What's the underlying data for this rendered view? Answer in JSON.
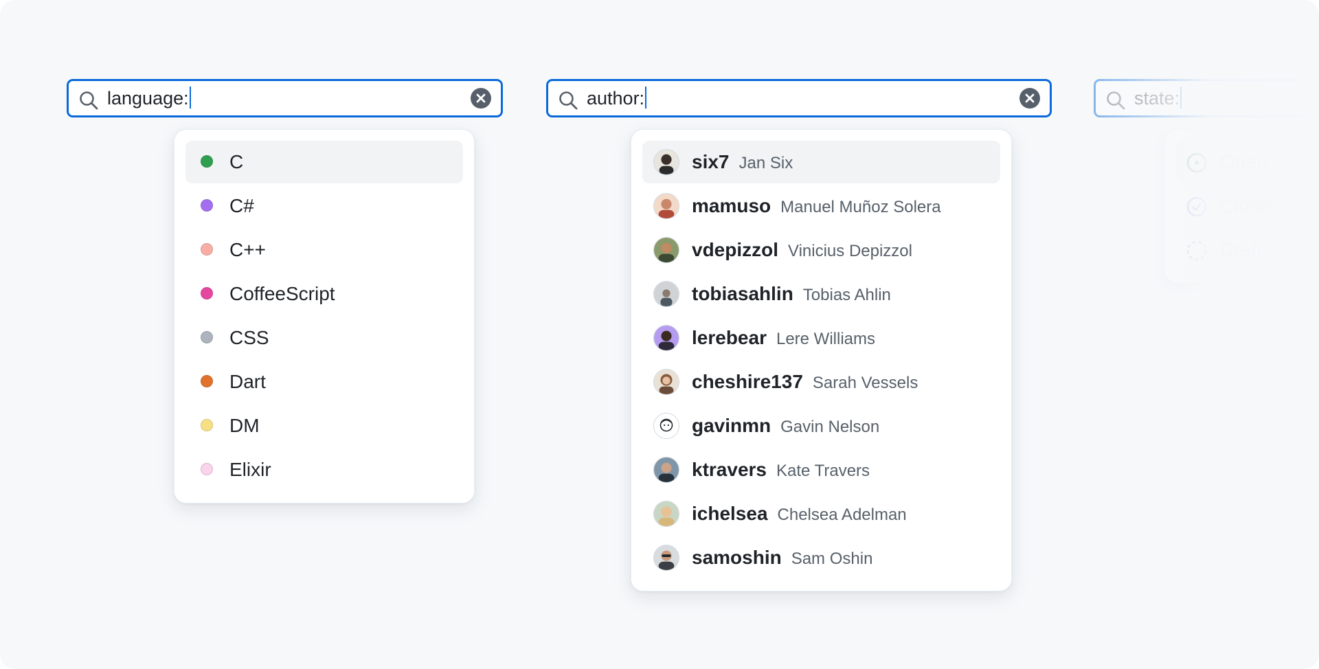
{
  "language_search": {
    "query": "language:",
    "suggestions": [
      {
        "label": "C",
        "color": "#2f9e4f"
      },
      {
        "label": "C#",
        "color": "#a46ef0"
      },
      {
        "label": "C++",
        "color": "#f8aea5"
      },
      {
        "label": "CoffeeScript",
        "color": "#e6479e"
      },
      {
        "label": "CSS",
        "color": "#adb4bd"
      },
      {
        "label": "Dart",
        "color": "#e0722c"
      },
      {
        "label": "DM",
        "color": "#f7e083"
      },
      {
        "label": "Elixir",
        "color": "#fbd3ea"
      }
    ]
  },
  "author_search": {
    "query": "author:",
    "suggestions": [
      {
        "login": "six7",
        "name": "Jan Six"
      },
      {
        "login": "mamuso",
        "name": "Manuel Muñoz Solera"
      },
      {
        "login": "vdepizzol",
        "name": "Vinicius Depizzol"
      },
      {
        "login": "tobiasahlin",
        "name": "Tobias Ahlin"
      },
      {
        "login": "lerebear",
        "name": "Lere Williams"
      },
      {
        "login": "cheshire137",
        "name": "Sarah Vessels"
      },
      {
        "login": "gavinmn",
        "name": "Gavin Nelson"
      },
      {
        "login": "ktravers",
        "name": "Kate Travers"
      },
      {
        "login": "ichelsea",
        "name": "Chelsea Adelman"
      },
      {
        "login": "samoshin",
        "name": "Sam Oshin"
      }
    ]
  },
  "state_search": {
    "query": "state:",
    "suggestions": [
      {
        "label": "Open",
        "icon": "issue-open-icon",
        "color": "#1a7f37"
      },
      {
        "label": "Closed",
        "icon": "issue-closed-icon",
        "color": "#8250df"
      },
      {
        "label": "Draft",
        "icon": "issue-draft-icon",
        "color": "#6e7781"
      }
    ]
  },
  "colors": {
    "accent": "#0969da",
    "selected_row": "#f1f3f5",
    "background": "#f6f8fa"
  }
}
